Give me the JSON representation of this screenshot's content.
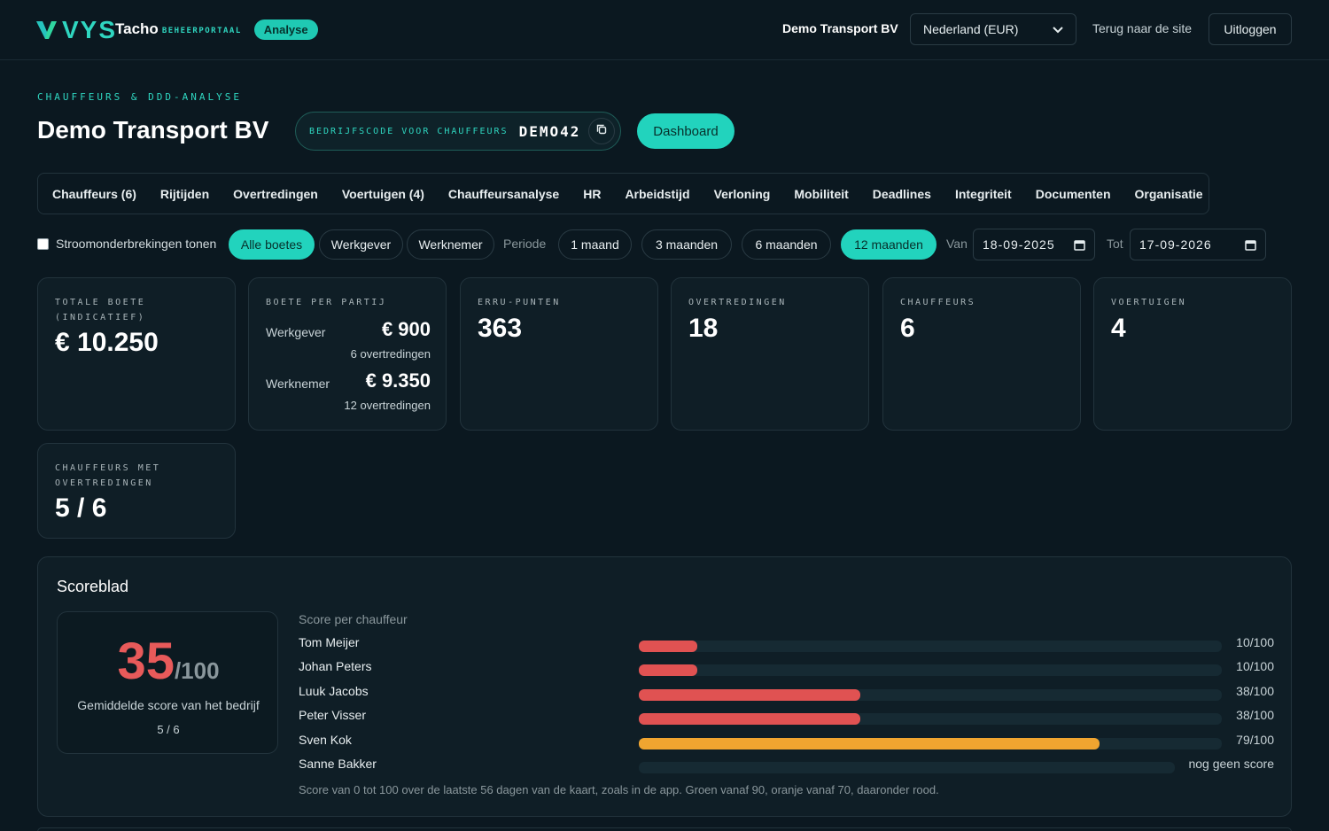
{
  "header": {
    "logo_text": "VYS",
    "product": "Tacho",
    "product_sub": "BEHEERPORTAAL",
    "badge": "Analyse",
    "company": "Demo Transport BV",
    "region": "Nederland (EUR)",
    "back_link": "Terug naar de site",
    "logout": "Uitloggen"
  },
  "page": {
    "eyebrow": "CHAUFFEURS & DDD-ANALYSE",
    "title": "Demo Transport BV",
    "code_label": "BEDRIJFSCODE VOOR CHAUFFEURS",
    "code_value": "DEMO42",
    "dashboard": "Dashboard"
  },
  "tabs": [
    "Chauffeurs (6)",
    "Rijtijden",
    "Overtredingen",
    "Voertuigen (4)",
    "Chauffeursanalyse",
    "HR",
    "Arbeidstijd",
    "Verloning",
    "Mobiliteit",
    "Deadlines",
    "Integriteit",
    "Documenten",
    "Organisatie"
  ],
  "filters": {
    "checkbox_label": "Stroomonderbrekingen tonen",
    "checkbox_checked": false,
    "fine_options": [
      "Alle boetes",
      "Werkgever",
      "Werknemer"
    ],
    "fine_active": "Alle boetes",
    "period_label": "Periode",
    "periods": [
      "1 maand",
      "3 maanden",
      "6 maanden",
      "12 maanden"
    ],
    "period_active": "12 maanden",
    "from_label": "Van",
    "from_date": "18-09-2025",
    "to_label": "Tot",
    "to_date": "17-09-2026"
  },
  "stats": {
    "total_fine_label": "TOTALE BOETE (INDICATIEF)",
    "total_fine": "€ 10.250",
    "per_party_label": "BOETE PER PARTIJ",
    "employer_label": "Werkgever",
    "employer_amount": "€ 900",
    "employer_count": "6 overtredingen",
    "employee_label": "Werknemer",
    "employee_amount": "€ 9.350",
    "employee_count": "12 overtredingen",
    "erru_label": "ERRU-PUNTEN",
    "erru": "363",
    "violations_label": "OVERTREDINGEN",
    "violations": "18",
    "drivers_label": "CHAUFFEURS",
    "drivers": "6",
    "vehicles_label": "VOERTUIGEN",
    "vehicles": "4",
    "drivers_viol_label": "CHAUFFEURS MET OVERTREDINGEN",
    "drivers_viol": "5 / 6"
  },
  "scoreboard": {
    "title": "Scoreblad",
    "avg_score": "35",
    "avg_denom": "/100",
    "avg_desc": "Gemiddelde score van het bedrijf",
    "avg_fraction": "5 / 6",
    "per_driver_title": "Score per chauffeur",
    "drivers": [
      {
        "name": "Tom Meijer",
        "score": 10,
        "label": "10/100",
        "color": "#e05252"
      },
      {
        "name": "Johan Peters",
        "score": 10,
        "label": "10/100",
        "color": "#e05252"
      },
      {
        "name": "Luuk Jacobs",
        "score": 38,
        "label": "38/100",
        "color": "#e05252"
      },
      {
        "name": "Peter Visser",
        "score": 38,
        "label": "38/100",
        "color": "#e05252"
      },
      {
        "name": "Sven Kok",
        "score": 79,
        "label": "79/100",
        "color": "#f0a530"
      },
      {
        "name": "Sanne Bakker",
        "score": null,
        "label": "nog geen score",
        "color": "#e05252"
      }
    ],
    "footnote": "Score van 0 tot 100 over de laatste 56 dagen van de kaart, zoals in de app. Groen vanaf 90, oranje vanaf 70, daaronder rood."
  },
  "colors": {
    "accent": "#22d3bd",
    "red": "#e05252",
    "orange": "#f0a530",
    "green": "#2fd6a0"
  }
}
